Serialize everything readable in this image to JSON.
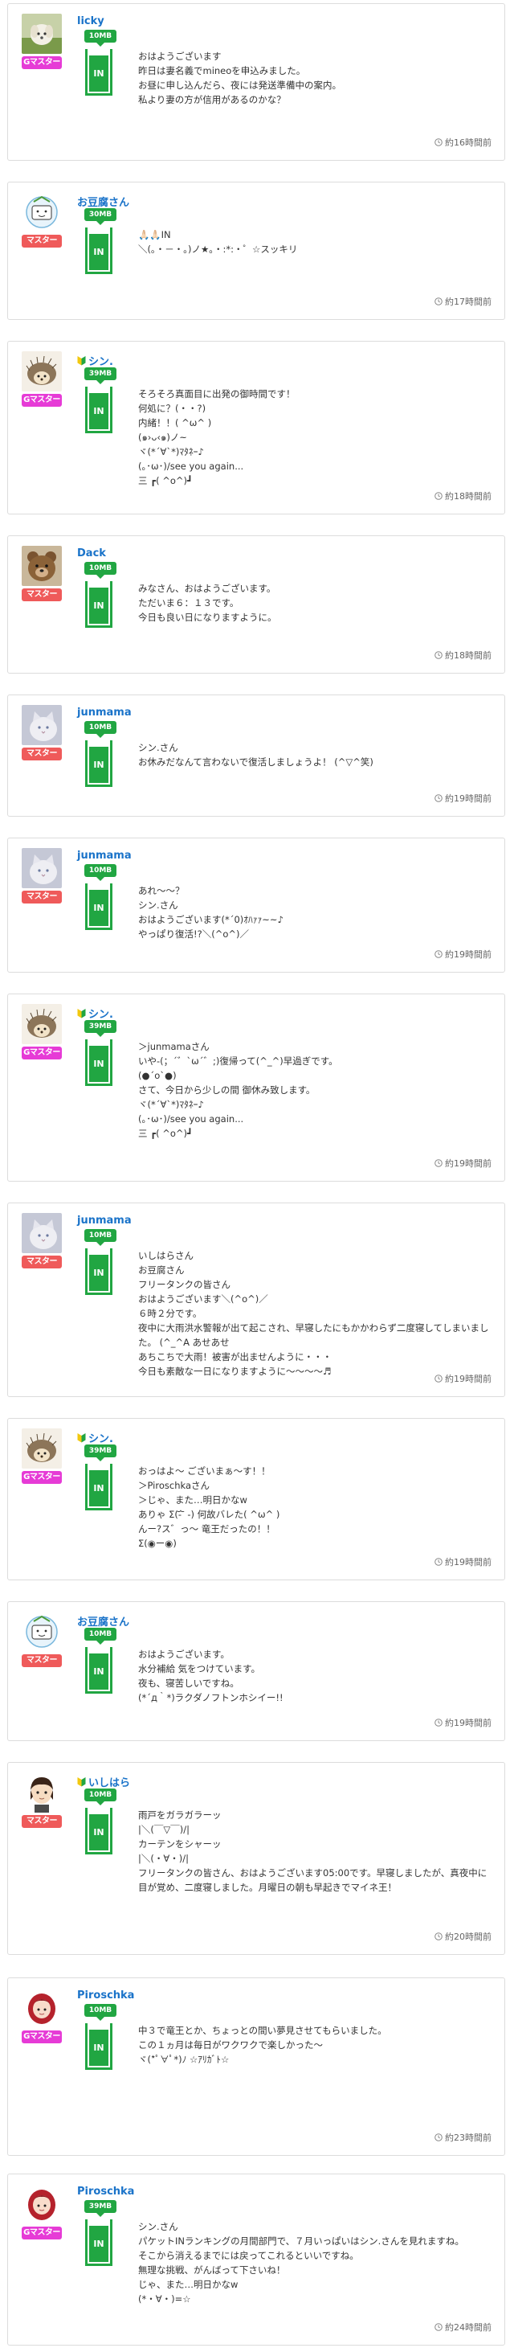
{
  "colors": {
    "accent_green": "#21a642",
    "username_blue": "#1a73c9",
    "gold_rank": "#e63bd6",
    "master_rank": "#ef5a5a"
  },
  "posts": [
    {
      "username": "licky",
      "rank": "Gマスター",
      "rank_type": "g",
      "beginner": false,
      "avatar": "dog-avatar",
      "amount": "10MB",
      "cup": "IN",
      "time": "約16時間前",
      "lines": [
        "おはようございます",
        "昨日は妻名義でmineoを申込みました。",
        "お昼に申し込んだら、夜には発送準備中の案内。",
        "私より妻の方が信用があるのかな？"
      ]
    },
    {
      "username": "お豆腐さん",
      "rank": "マスター",
      "rank_type": "m",
      "beginner": false,
      "avatar": "tofu-avatar",
      "amount": "30MB",
      "cup": "IN",
      "time": "約17時間前",
      "lines": [
        "🙏🏻🙏🏻IN",
        "＼(｡・－・｡)ノ★｡・:*:・゜☆スッキリ"
      ]
    },
    {
      "username": "シン.",
      "rank": "Gマスター",
      "rank_type": "g",
      "beginner": true,
      "avatar": "hedgehog-avatar",
      "amount": "39MB",
      "cup": "IN",
      "time": "約18時間前",
      "lines": [
        "そろそろ真面目に出発の御時間です！",
        "何処に？(・・?)",
        "内緒！！( ^ω^ )",
        "(๑›ᴗ‹๑)ノ~",
        "ヾ(*´∀`*)ﾏﾀﾈｰ♪",
        "(｡･ω･)/see you again...",
        "三 ┏( ^o^)┛"
      ]
    },
    {
      "username": "Dack",
      "rank": "マスター",
      "rank_type": "m",
      "beginner": false,
      "avatar": "bear-avatar",
      "amount": "10MB",
      "cup": "IN",
      "time": "約18時間前",
      "lines": [
        "みなさん、おはようございます。",
        "ただいま６：１３です。",
        "今日も良い日になりますように。"
      ]
    },
    {
      "username": "junmama",
      "rank": "マスター",
      "rank_type": "m",
      "beginner": false,
      "avatar": "cat-avatar",
      "amount": "10MB",
      "cup": "IN",
      "time": "約19時間前",
      "lines": [
        "シン.さん",
        "お休みだなんて言わないで復活しましょうよ！ (^▽^笑)"
      ]
    },
    {
      "username": "junmama",
      "rank": "マスター",
      "rank_type": "m",
      "beginner": false,
      "avatar": "cat-avatar",
      "amount": "10MB",
      "cup": "IN",
      "time": "約19時間前",
      "lines": [
        "あれ〜〜？",
        "シン.さん",
        "おはようございます(*´0)ｵﾊｧｧ~~♪",
        "やっぱり復活!?＼(^o^)／"
      ]
    },
    {
      "username": "シン.",
      "rank": "Gマスター",
      "rank_type": "g",
      "beginner": true,
      "avatar": "hedgehog-avatar",
      "amount": "39MB",
      "cup": "IN",
      "time": "約19時間前",
      "lines": [
        "＞junmamaさん",
        "いや-(；´゛`ω´゛;)復帰って(^_^)早過ぎです。",
        "(●´ο`●)",
        "さて、今日から少しの間 御休み致します。",
        "ヾ(*´∀`*)ﾏﾀﾈｰ♪",
        "(｡･ω･)/see you again...",
        "三 ┏( ^o^)┛"
      ]
    },
    {
      "username": "junmama",
      "rank": "マスター",
      "rank_type": "m",
      "beginner": false,
      "avatar": "cat-avatar",
      "amount": "10MB",
      "cup": "IN",
      "time": "約19時間前",
      "lines": [
        "いしはらさん",
        "お豆腐さん",
        "フリータンクの皆さん",
        "おはようございます＼(^o^)／",
        "６時２分です。",
        "夜中に大雨洪水警報が出て起こされ、早寝したにもかかわらず二度寝してしまいました。 (^_^A あせあせ",
        "あちこちで大雨！被害が出ませんように・・・",
        "今日も素敵な一日になりますように〜〜〜〜♬"
      ]
    },
    {
      "username": "シン.",
      "rank": "Gマスター",
      "rank_type": "g",
      "beginner": true,
      "avatar": "hedgehog-avatar",
      "amount": "39MB",
      "cup": "IN",
      "time": "約19時間前",
      "lines": [
        "おっはよ～ ございまぁ～す！！",
        "＞Piroschkaさん",
        "＞じゃ、また…明日かなw",
        "ありゃ Σ(-᷄ ᷅ -) 何故バレた( ^ω^ )",
        "んー?ス゛っ〜 竜王だったの！！",
        "Σ(◉ー◉)"
      ]
    },
    {
      "username": "お豆腐さん",
      "rank": "マスター",
      "rank_type": "m",
      "beginner": false,
      "avatar": "tofu-avatar",
      "amount": "10MB",
      "cup": "IN",
      "time": "約19時間前",
      "lines": [
        "おはようございます。",
        "水分補給 気をつけています。",
        "夜も、寝苦しいですね。",
        "(*´д｀*)ラクダノフトンホシイー!!"
      ]
    },
    {
      "username": "いしはら",
      "rank": "マスター",
      "rank_type": "m",
      "beginner": true,
      "avatar": "boy-avatar",
      "amount": "10MB",
      "cup": "IN",
      "time": "約20時間前",
      "lines": [
        "雨戸をガラガラーッ",
        "|＼(￣▽￣)/|",
        "カーテンをシャーッ",
        "|＼(・∀・)/|",
        "フリータンクの皆さん、おはようございます05:00です。早寝しましたが、真夜中に目が覚め、二度寝しました。月曜日の朝も早起きでマイネ王！"
      ]
    },
    {
      "username": "Piroschka",
      "rank": "Gマスター",
      "rank_type": "g",
      "beginner": false,
      "avatar": "girl-avatar",
      "amount": "10MB",
      "cup": "IN",
      "time": "約23時間前",
      "lines": [
        "中３で竜王とか、ちょっとの間い夢見させてもらいました。",
        "この１ヵ月は毎日がワクワクで楽しかった〜",
        "ヾ(*ﾟ∀ﾟ*)ﾉ ☆ｱﾘｶﾞﾄ☆"
      ]
    },
    {
      "username": "Piroschka",
      "rank": "Gマスター",
      "rank_type": "g",
      "beginner": false,
      "avatar": "girl-avatar",
      "amount": "39MB",
      "cup": "IN",
      "time": "約24時間前",
      "lines": [
        "シン.さん",
        "パケットINランキングの月間部門で、７月いっぱいはシン.さんを見れますね。",
        "そこから消えるまでには戻ってこれるといいですね。",
        "無理な挑戦、がんばって下さいね！",
        "じゃ、また…明日かなw",
        "(*・∀・)=☆"
      ]
    }
  ]
}
